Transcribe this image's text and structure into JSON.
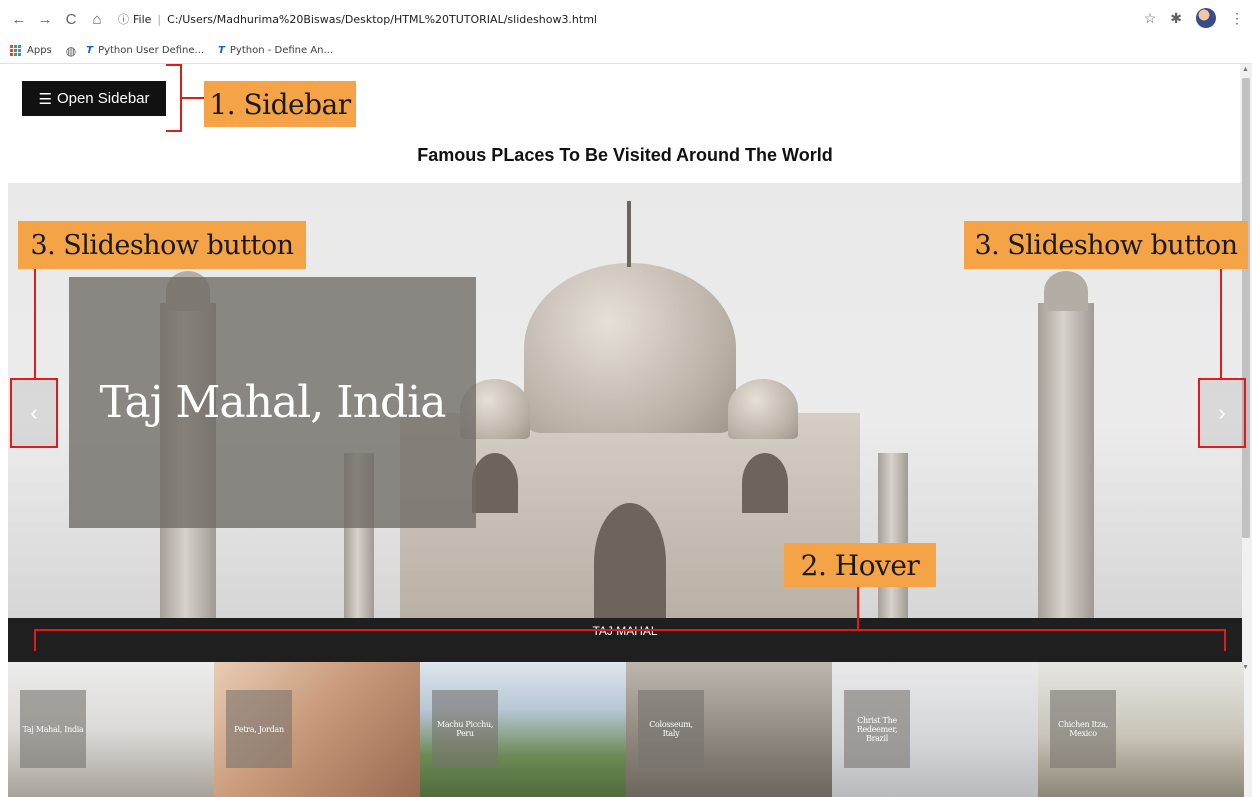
{
  "browser": {
    "url_prefix": "File",
    "url": "C:/Users/Madhurima%20Biswas/Desktop/HTML%20TUTORIAL/slideshow3.html"
  },
  "bookmarks": [
    {
      "label": "Apps"
    },
    {
      "label": "Python User Define..."
    },
    {
      "label": "Python - Define An..."
    }
  ],
  "sidebar_button": {
    "icon": "menu-icon",
    "label": "Open Sidebar"
  },
  "annotations": {
    "sidebar": "1. Sidebar",
    "slideshow_left": "3. Slideshow button",
    "slideshow_right": "3. Slideshow button",
    "hover": "2. Hover"
  },
  "page_title": "Famous PLaces To Be Visited Around The World",
  "slideshow": {
    "caption": "Taj Mahal, India",
    "prev_glyph": "‹",
    "next_glyph": "›",
    "hover_caption": "TAJ MAHAL"
  },
  "thumbnails": [
    {
      "label": "Taj Mahal, India"
    },
    {
      "label": "Petra, Jordan"
    },
    {
      "label": "Machu Picchu, Peru"
    },
    {
      "label": "Colosseum, Italy"
    },
    {
      "label": "Christ The Redeemer, Brazil"
    },
    {
      "label": "Chichen Itza, Mexico"
    }
  ],
  "colors": {
    "annotation_fill": "#f4a347",
    "annotation_outline": "#e01b1b",
    "button_bg": "#111111",
    "hover_bar_bg": "#1f1f1f"
  }
}
